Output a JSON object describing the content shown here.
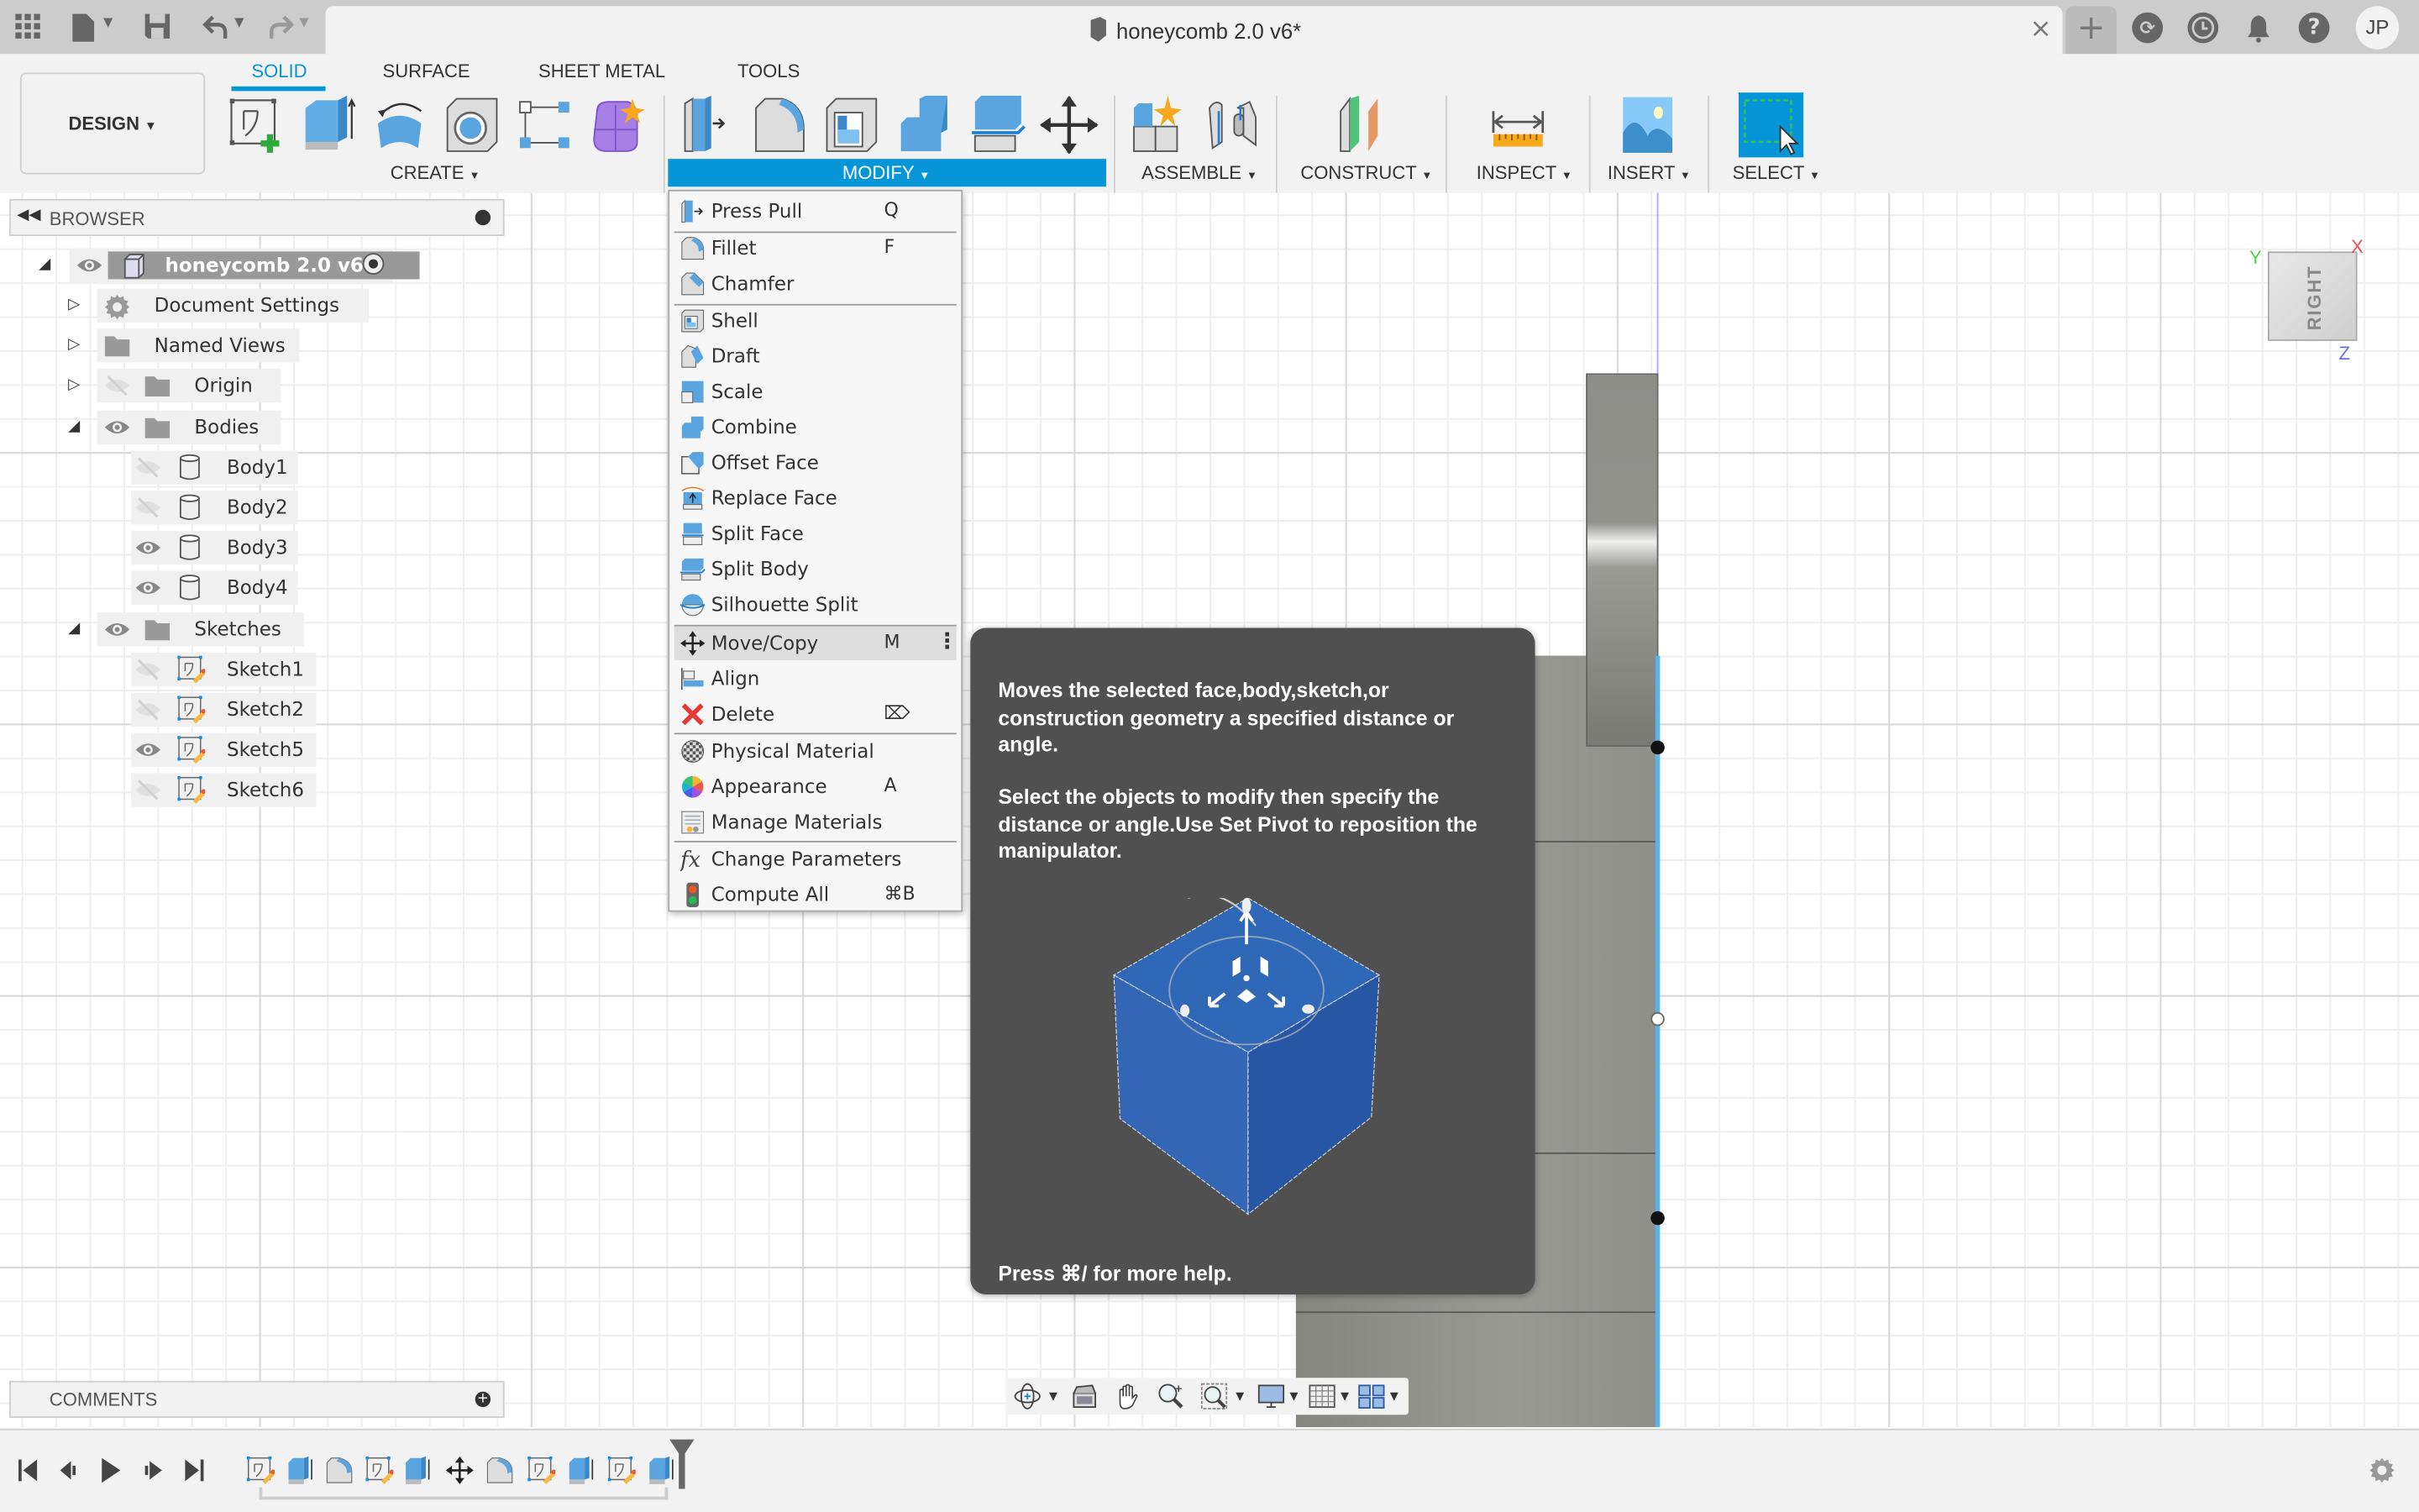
{
  "app": {
    "document_title": "honeycomb 2.0 v6*",
    "user_initials": "JP"
  },
  "quick_access": {
    "icons": [
      "grid-menu-icon",
      "file-icon",
      "save-icon",
      "undo-icon",
      "redo-icon"
    ]
  },
  "top_right_icons": [
    "new-tab-icon",
    "extensions-icon",
    "job-status-icon",
    "notifications-icon",
    "help-icon"
  ],
  "toolbar": {
    "workspace": "DESIGN",
    "tabs": [
      {
        "label": "SOLID",
        "active": true
      },
      {
        "label": "SURFACE",
        "active": false
      },
      {
        "label": "SHEET METAL",
        "active": false
      },
      {
        "label": "TOOLS",
        "active": false
      }
    ],
    "groups": [
      {
        "label": "CREATE",
        "tools": [
          "create-sketch",
          "extrude",
          "revolve",
          "hole",
          "rectangular-pattern",
          "create-form"
        ]
      },
      {
        "label": "MODIFY",
        "active": true,
        "tools": [
          "press-pull",
          "fillet",
          "shell",
          "combine",
          "split-body",
          "move-copy"
        ]
      },
      {
        "label": "ASSEMBLE",
        "tools": [
          "new-component",
          "joint"
        ]
      },
      {
        "label": "CONSTRUCT",
        "tools": [
          "offset-plane"
        ]
      },
      {
        "label": "INSPECT",
        "tools": [
          "measure"
        ]
      },
      {
        "label": "INSERT",
        "tools": [
          "insert-canvas"
        ]
      },
      {
        "label": "SELECT",
        "tools": [
          "window-select"
        ]
      }
    ]
  },
  "browser": {
    "title": "BROWSER",
    "root": {
      "label": "honeycomb 2.0 v6"
    },
    "items": [
      {
        "label": "Document Settings",
        "icon": "gear",
        "expanded": false,
        "visible": null
      },
      {
        "label": "Named Views",
        "icon": "folder",
        "expanded": false,
        "visible": null
      },
      {
        "label": "Origin",
        "icon": "folder",
        "expanded": false,
        "visible": false
      },
      {
        "label": "Bodies",
        "icon": "folder",
        "expanded": true,
        "visible": true,
        "children": [
          {
            "label": "Body1",
            "visible": false
          },
          {
            "label": "Body2",
            "visible": false
          },
          {
            "label": "Body3",
            "visible": true
          },
          {
            "label": "Body4",
            "visible": true
          }
        ]
      },
      {
        "label": "Sketches",
        "icon": "folder",
        "expanded": true,
        "visible": true,
        "children": [
          {
            "label": "Sketch1",
            "visible": false
          },
          {
            "label": "Sketch2",
            "visible": false
          },
          {
            "label": "Sketch5",
            "visible": true
          },
          {
            "label": "Sketch6",
            "visible": false
          }
        ]
      }
    ]
  },
  "comments": {
    "title": "COMMENTS"
  },
  "modify_menu": {
    "items": [
      {
        "label": "Press Pull",
        "shortcut": "Q",
        "icon": "press-pull"
      },
      {
        "label": "Fillet",
        "shortcut": "F",
        "icon": "fillet"
      },
      {
        "label": "Chamfer",
        "shortcut": "",
        "icon": "chamfer"
      },
      {
        "label": "Shell",
        "shortcut": "",
        "icon": "shell"
      },
      {
        "label": "Draft",
        "shortcut": "",
        "icon": "draft"
      },
      {
        "label": "Scale",
        "shortcut": "",
        "icon": "scale"
      },
      {
        "label": "Combine",
        "shortcut": "",
        "icon": "combine"
      },
      {
        "label": "Offset Face",
        "shortcut": "",
        "icon": "offset-face"
      },
      {
        "label": "Replace Face",
        "shortcut": "",
        "icon": "replace-face"
      },
      {
        "label": "Split Face",
        "shortcut": "",
        "icon": "split-face"
      },
      {
        "label": "Split Body",
        "shortcut": "",
        "icon": "split-body"
      },
      {
        "label": "Silhouette Split",
        "shortcut": "",
        "icon": "silhouette-split"
      },
      {
        "label": "Move/Copy",
        "shortcut": "M",
        "icon": "move-copy",
        "highlighted": true
      },
      {
        "label": "Align",
        "shortcut": "",
        "icon": "align"
      },
      {
        "label": "Delete",
        "shortcut": "⌦",
        "icon": "delete"
      },
      {
        "label": "Physical Material",
        "shortcut": "",
        "icon": "physical-material"
      },
      {
        "label": "Appearance",
        "shortcut": "A",
        "icon": "appearance"
      },
      {
        "label": "Manage Materials",
        "shortcut": "",
        "icon": "manage-materials"
      },
      {
        "label": "Change Parameters",
        "shortcut": "",
        "icon": "change-parameters"
      },
      {
        "label": "Compute All",
        "shortcut": "⌘B",
        "icon": "compute-all"
      }
    ]
  },
  "tooltip": {
    "description": "Moves the selected face,body,sketch,or construction geometry a specified distance or angle.",
    "instructions": "Select the objects to modify then specify the distance or angle.Use Set Pivot to reposition the manipulator.",
    "help": "Press ⌘/ for more help."
  },
  "viewcube": {
    "face": "RIGHT",
    "axes": {
      "x": "X",
      "y": "Y",
      "z": "Z"
    }
  },
  "navbar": {
    "tools": [
      "orbit",
      "look-at",
      "pan",
      "zoom",
      "zoom-window",
      "display-settings",
      "grid-settings",
      "viewports"
    ]
  },
  "timeline": {
    "controls": [
      "go-to-start",
      "step-back",
      "play",
      "step-forward",
      "go-to-end"
    ],
    "features": [
      "sketch",
      "extrude",
      "fillet",
      "sketch",
      "extrude",
      "move",
      "fillet",
      "sketch",
      "extrude",
      "sketch",
      "extrude"
    ]
  },
  "colors": {
    "accent": "#0696d7",
    "tooltip_bg": "#505050",
    "titlebar_bg": "#cccccc",
    "panel_bg": "#f2f2f2",
    "model_gray": "#9a9a95",
    "cube_blue": "#2e63b8"
  }
}
